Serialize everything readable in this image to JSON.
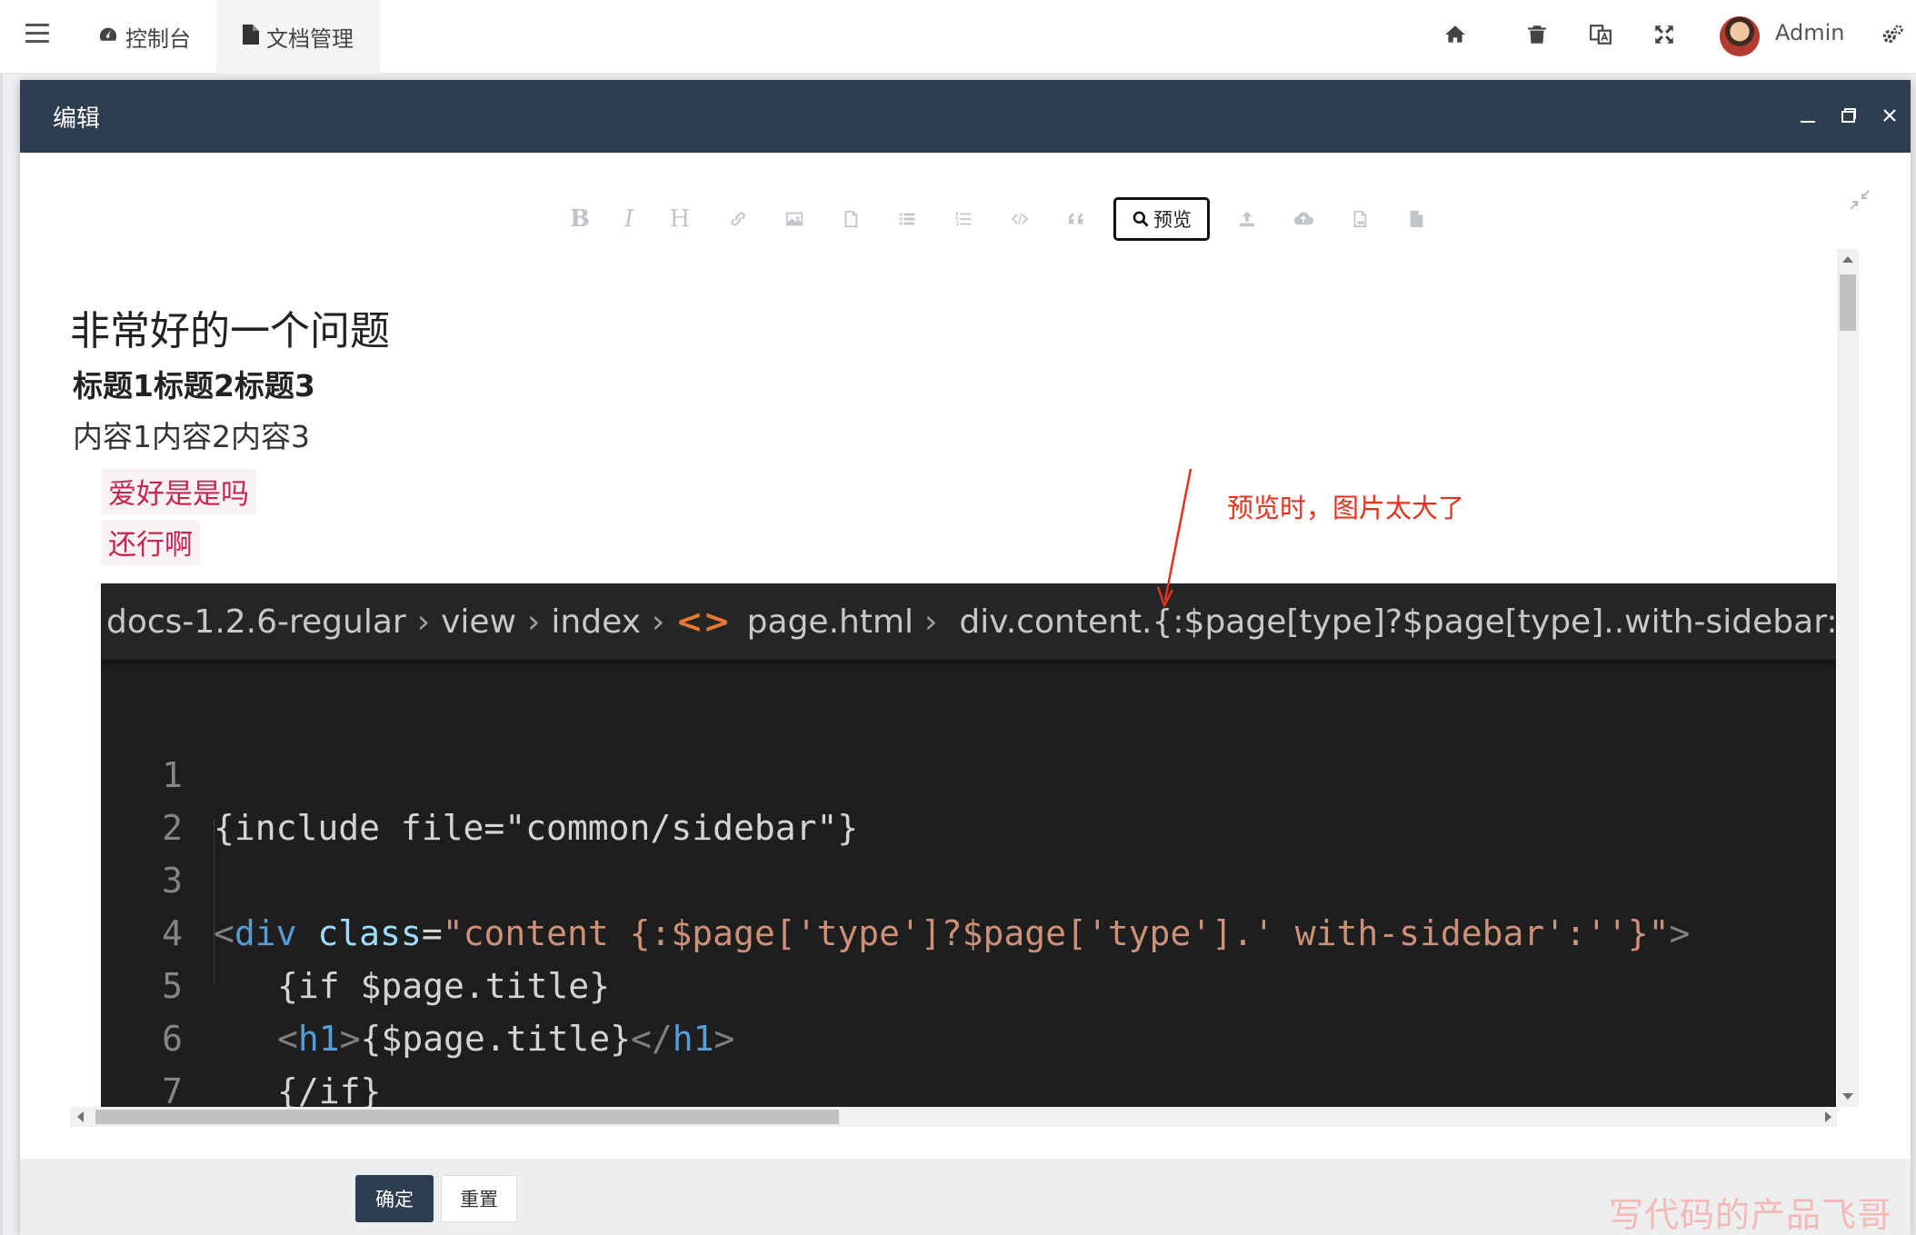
{
  "topbar": {
    "tabs": [
      {
        "label": "控制台",
        "icon": "dashboard-icon"
      },
      {
        "label": "文档管理",
        "icon": "file-icon"
      }
    ],
    "right_icons": [
      "home-icon",
      "trash-icon",
      "translate-icon",
      "fullscreen-icon"
    ],
    "user": "Admin"
  },
  "layer": {
    "title": "编辑",
    "toolbar": {
      "bold": "B",
      "italic": "I",
      "heading": "H",
      "preview_label": "预览"
    },
    "doc": {
      "h1": "非常好的一个问题",
      "h2": "标题1标题2标题3",
      "p": "内容1内容2内容3",
      "code1": "爱好是是吗",
      "code2": "还行啊"
    },
    "image": {
      "crumb_project": "docs-1.2.6-regular",
      "crumb_view": "view",
      "crumb_index": "index",
      "crumb_tag": "<>",
      "crumb_file": "page.html",
      "crumb_element": "div.content.{:$page[type]?$page[type]..with-sidebar:}",
      "line_numbers": [
        "1",
        "2",
        "3",
        "4",
        "5",
        "6",
        "7"
      ],
      "line1": "{include file=\"common/sidebar\"}",
      "line3_a": "<",
      "line3_b": "div",
      "line3_c": " class",
      "line3_d": "=",
      "line3_e": "\"content {:$page['type']?$page['type'].' with-sidebar':''}\"",
      "line3_f": ">",
      "line4": "{if $page.title}",
      "line5_a": "<",
      "line5_b": "h1",
      "line5_c": ">",
      "line5_d": "{$page.title}",
      "line5_e": "</",
      "line5_f": "h1",
      "line5_g": ">",
      "line6": "{/if}"
    },
    "annotation": "预览时，图片太大了",
    "buttons": {
      "ok": "确定",
      "reset": "重置"
    }
  },
  "watermark": "写代码的产品飞哥",
  "colors": {
    "nav_dark": "#2c3e50",
    "annotation_red": "#e8301d",
    "code_bg": "#1e1e1e",
    "inline_code_fg": "#c7254e"
  }
}
